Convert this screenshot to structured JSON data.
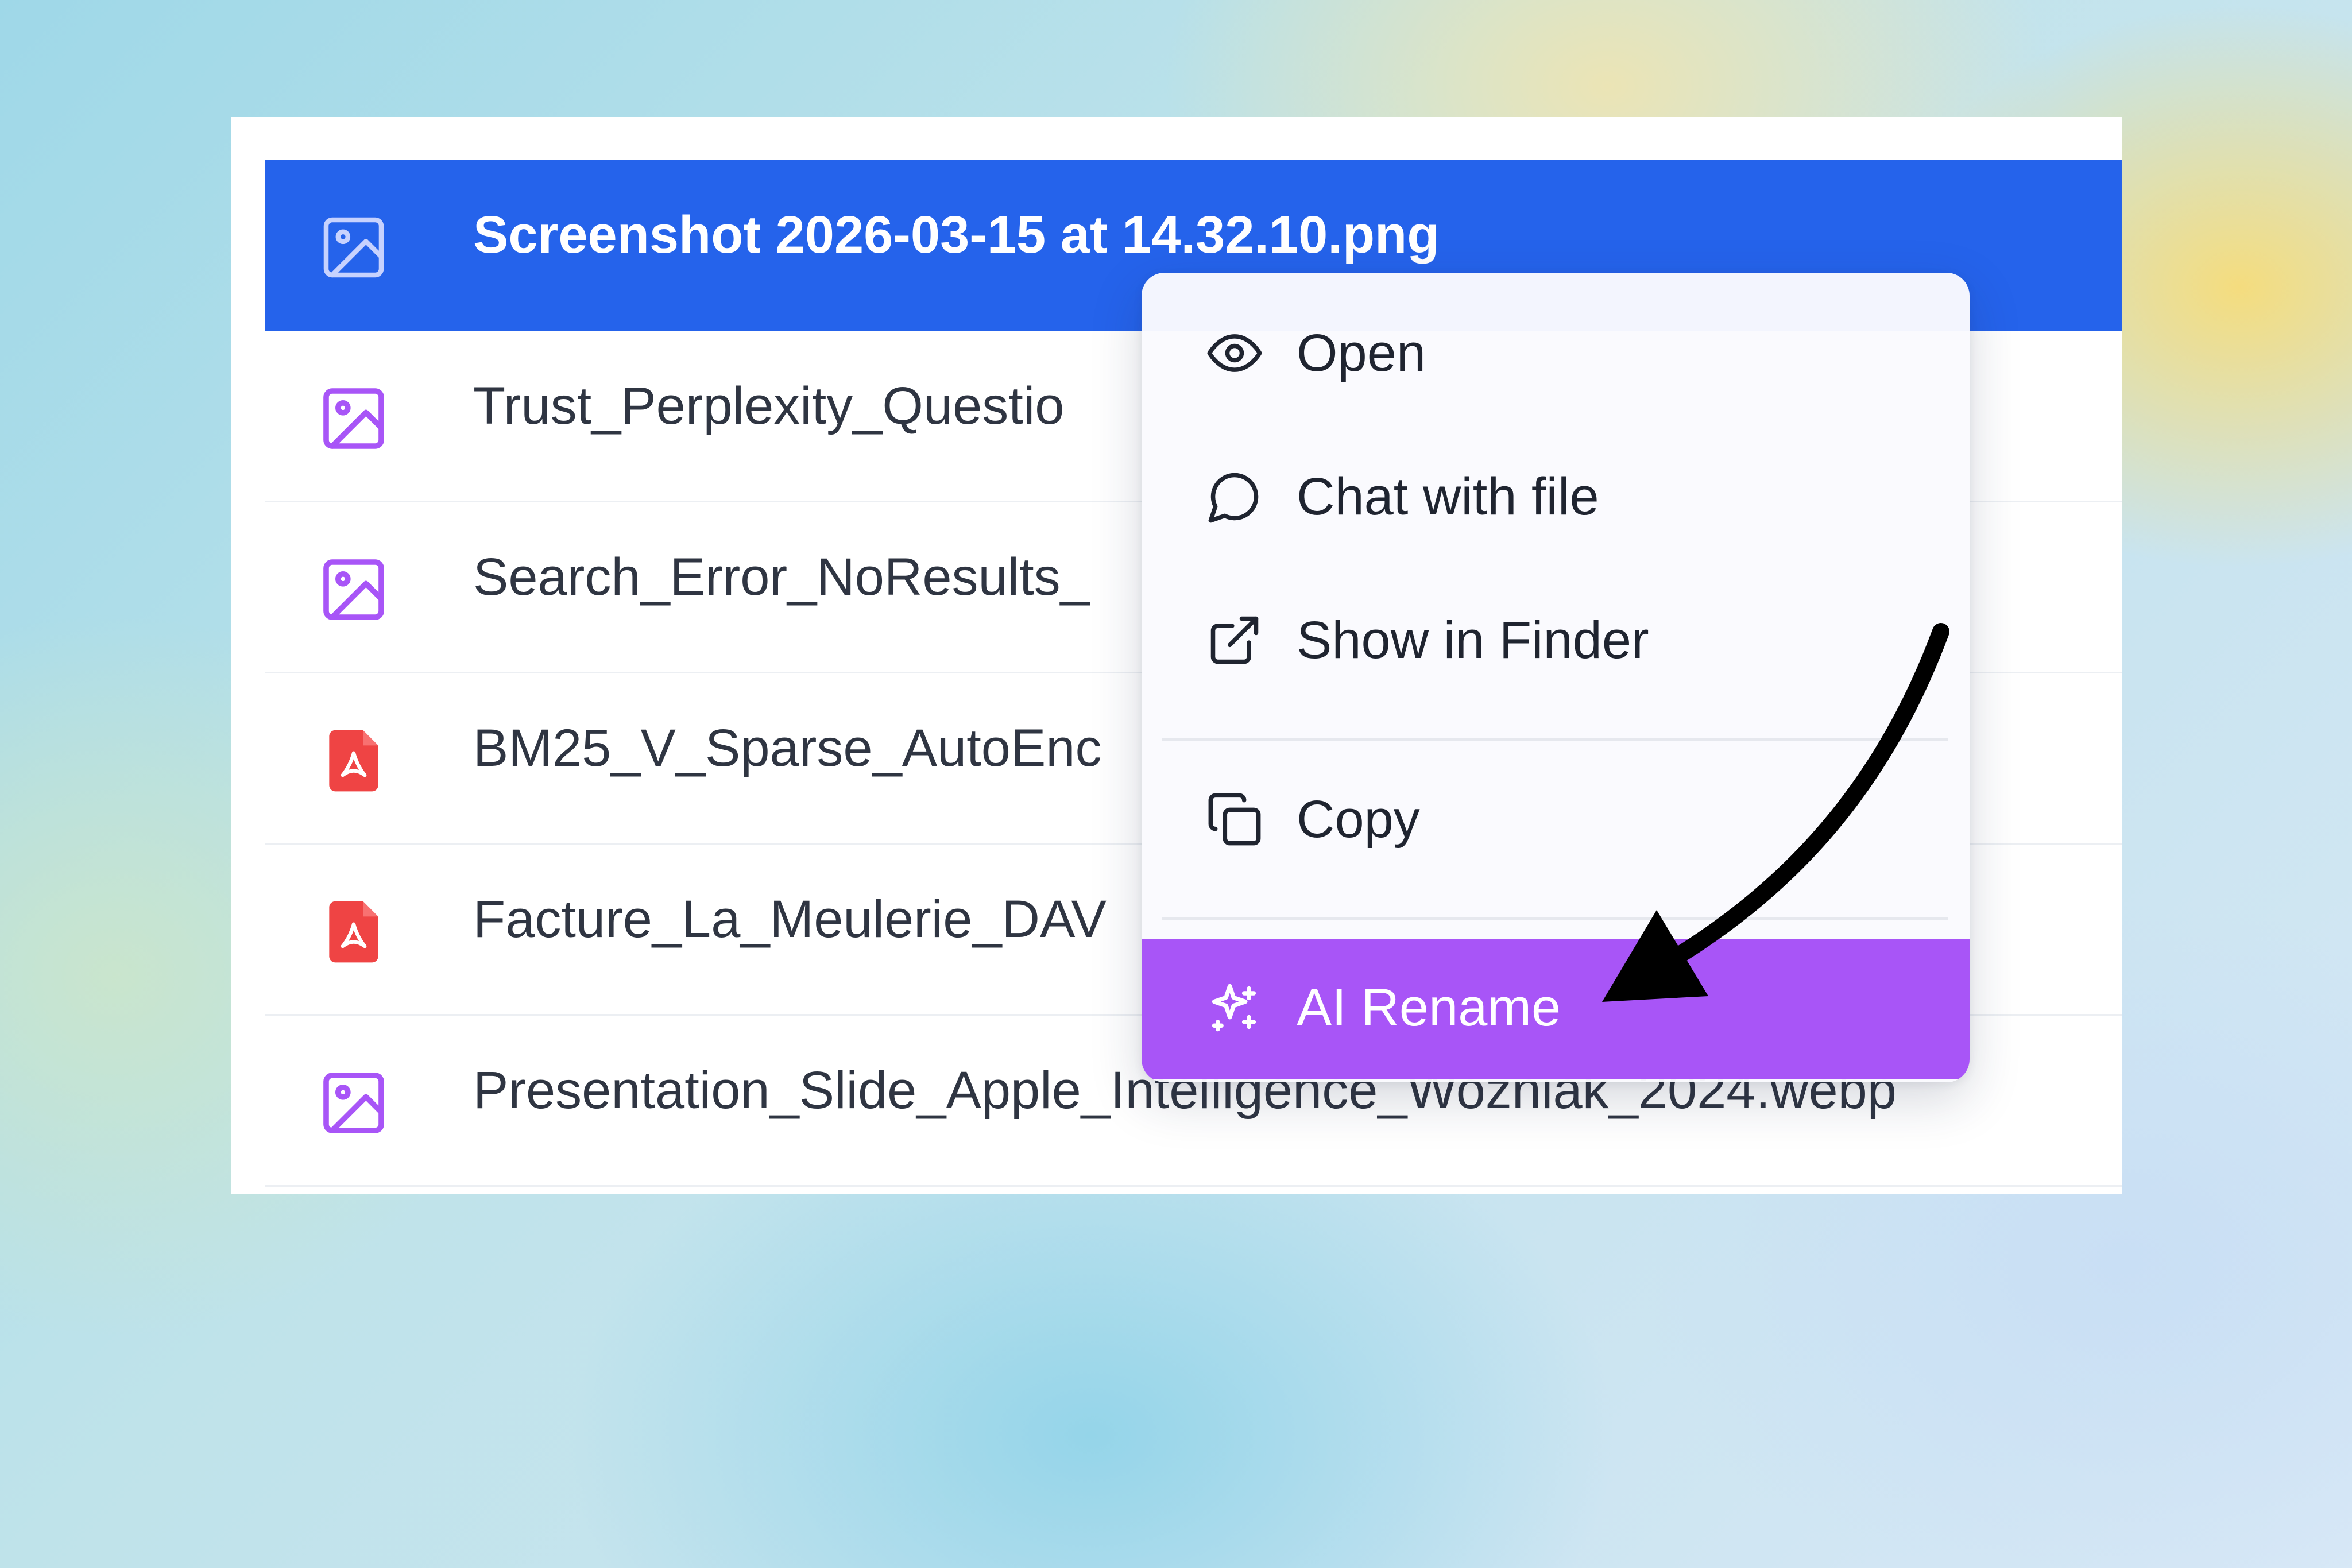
{
  "files": [
    {
      "name": "Screenshot 2026-03-15 at 14.32.10.png",
      "icon": "image-icon",
      "selected": true
    },
    {
      "name": "Trust_Perplexity_Questio",
      "icon": "image-icon",
      "selected": false
    },
    {
      "name": "Search_Error_NoResults_",
      "icon": "image-icon",
      "selected": false
    },
    {
      "name": "BM25_V_Sparse_AutoEnc",
      "icon": "pdf-icon",
      "selected": false
    },
    {
      "name": "Facture_La_Meulerie_DAV",
      "icon": "pdf-icon",
      "selected": false
    },
    {
      "name": "Presentation_Slide_Apple_Intelligence_Wozniak_2024.webp",
      "icon": "image-icon",
      "selected": false
    }
  ],
  "context_menu": {
    "items": [
      {
        "label": "Open",
        "icon": "eye-icon"
      },
      {
        "label": "Chat with file",
        "icon": "chat-bubble-icon"
      },
      {
        "label": "Show in Finder",
        "icon": "external-link-icon"
      },
      {
        "label": "Copy",
        "icon": "copy-icon"
      },
      {
        "label": "AI Rename",
        "icon": "sparkles-icon",
        "highlighted": true
      }
    ]
  },
  "colors": {
    "selection_blue": "#2563eb",
    "ai_purple": "#a855f7",
    "image_icon_purple": "#a855f7",
    "pdf_icon_red": "#ef4444"
  }
}
